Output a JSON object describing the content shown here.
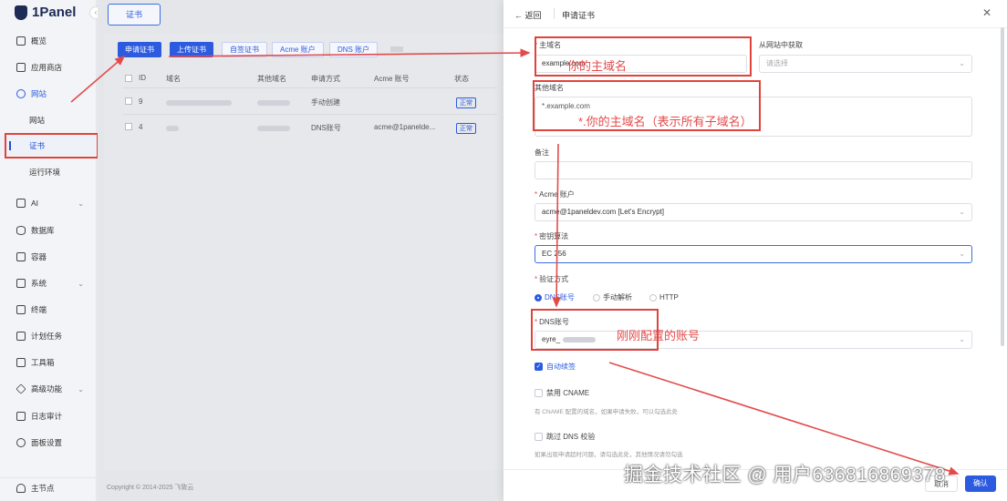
{
  "app": {
    "name": "1Panel",
    "collapse_icon": "‹"
  },
  "sidebar": {
    "items": [
      {
        "label": "概览",
        "icon": "home-icon"
      },
      {
        "label": "应用商店",
        "icon": "grid-icon"
      },
      {
        "label": "网站",
        "icon": "globe-icon",
        "state": "expanded"
      },
      {
        "label": "网站",
        "sub": true
      },
      {
        "label": "证书",
        "sub": true,
        "state": "current"
      },
      {
        "label": "运行环境",
        "sub": true
      },
      {
        "label": "AI",
        "icon": "robot-icon",
        "chevron": "⌄"
      },
      {
        "label": "数据库",
        "icon": "database-icon"
      },
      {
        "label": "容器",
        "icon": "container-icon"
      },
      {
        "label": "系统",
        "icon": "system-icon",
        "chevron": "⌄"
      },
      {
        "label": "终端",
        "icon": "terminal-icon"
      },
      {
        "label": "计划任务",
        "icon": "calendar-icon"
      },
      {
        "label": "工具箱",
        "icon": "toolbox-icon"
      },
      {
        "label": "高级功能",
        "icon": "diamond-icon",
        "chevron": "⌄"
      },
      {
        "label": "日志审计",
        "icon": "log-icon"
      },
      {
        "label": "面板设置",
        "icon": "settings-icon"
      }
    ],
    "footer": "主节点"
  },
  "main": {
    "tab": "证书",
    "toolbar": [
      "申请证书",
      "上传证书",
      "自签证书",
      "Acme 账户",
      "DNS 账户"
    ],
    "columns": [
      "ID",
      "域名",
      "其他域名",
      "申请方式",
      "Acme 账号",
      "状态"
    ],
    "rows": [
      {
        "id": "9",
        "method": "手动创建",
        "acme": "",
        "status": "正常"
      },
      {
        "id": "4",
        "method": "DNS账号",
        "acme": "acme@1paneldе...",
        "status": "正常"
      }
    ],
    "copyright": "Copyright © 2014-2025 飞致云"
  },
  "drawer": {
    "back": "返回",
    "title": "申请证书",
    "close": "✕",
    "primary_domain": {
      "label": "主域名",
      "value": "example.com"
    },
    "from_site": {
      "label": "从网站中获取",
      "placeholder": "请选择"
    },
    "other_domains": {
      "label": "其他域名",
      "value": "*.example.com"
    },
    "remark": {
      "label": "备注",
      "value": ""
    },
    "acme": {
      "label": "Acme 账户",
      "value": "acme@1paneldev.com [Let's Encrypt]"
    },
    "key_algo": {
      "label": "密钥算法",
      "value": "EC 256"
    },
    "verify": {
      "label": "验证方式",
      "options": [
        "DNS账号",
        "手动解析",
        "HTTP"
      ],
      "selected": "DNS账号"
    },
    "dns_account": {
      "label": "DNS账号",
      "value": "eyre_"
    },
    "auto_renew": {
      "label": "自动续签",
      "checked": true
    },
    "disable_cname": {
      "label": "禁用 CNAME",
      "hint": "有 CNAME 配置的域名，如果申请失败，可以勾选此处"
    },
    "skip_dns": {
      "label": "跳过 DNS 校验",
      "hint": "如果出现申请超时问题，请勾选此处，其他情况请勿勾选"
    },
    "buttons": {
      "cancel": "取消",
      "confirm": "确认"
    }
  },
  "annotations": {
    "a1": "你的主域名",
    "a2": "*.你的主域名（表示所有子域名）",
    "a3": "刚刚配置的账号",
    "color": "#e34b4b"
  },
  "watermark": "掘金技术社区 @ 用户636816869378"
}
